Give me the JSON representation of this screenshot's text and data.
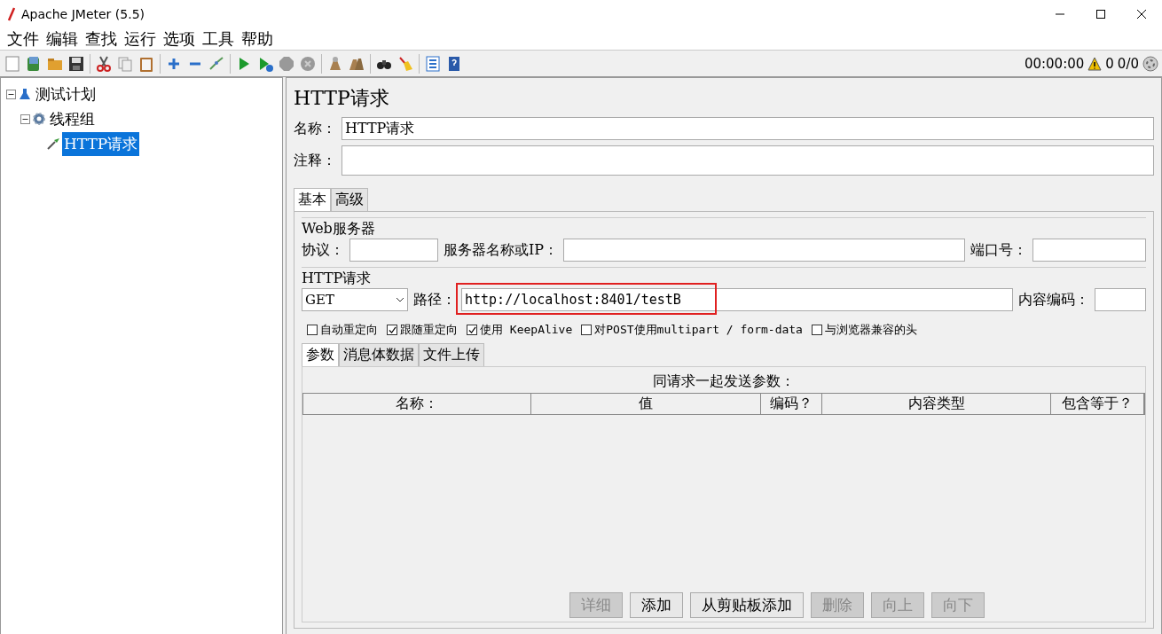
{
  "window": {
    "title": "Apache JMeter (5.5)"
  },
  "menu": [
    "文件",
    "编辑",
    "查找",
    "运行",
    "选项",
    "工具",
    "帮助"
  ],
  "status": {
    "elapsed": "00:00:00",
    "warnings": "0",
    "threads": "0/0"
  },
  "tree": [
    {
      "label": "测试计划",
      "kind": "plan",
      "expanded": true,
      "selected": false,
      "children": [
        {
          "label": "线程组",
          "kind": "group",
          "expanded": true,
          "selected": false,
          "children": [
            {
              "label": "HTTP请求",
              "kind": "sampler",
              "selected": true
            }
          ]
        }
      ]
    }
  ],
  "panel": {
    "title": "HTTP请求",
    "name_label": "名称：",
    "name_value": "HTTP请求",
    "comments_label": "注释："
  },
  "tabs": [
    {
      "label": "基本",
      "selected": true
    },
    {
      "label": "高级",
      "selected": false
    }
  ],
  "web_server": {
    "title": "Web服务器",
    "protocol_label": "协议：",
    "server_label": "服务器名称或IP：",
    "port_label": "端口号："
  },
  "http_request": {
    "title": "HTTP请求",
    "method": "GET",
    "path_label": "路径：",
    "path_value": "http://localhost:8401/testB",
    "path_highlighted": true,
    "encoding_label": "内容编码："
  },
  "options": [
    {
      "label": "自动重定向",
      "checked": false
    },
    {
      "label": "跟随重定向",
      "checked": true
    },
    {
      "label": "使用 KeepAlive",
      "checked": true
    },
    {
      "label": "对POST使用multipart / form-data",
      "checked": false
    },
    {
      "label": "与浏览器兼容的头",
      "checked": false
    }
  ],
  "sub_tabs": [
    {
      "label": "参数",
      "selected": true
    },
    {
      "label": "消息体数据",
      "selected": false
    },
    {
      "label": "文件上传",
      "selected": false
    }
  ],
  "params": {
    "caption": "同请求一起发送参数：",
    "columns": [
      "名称：",
      "值",
      "编码？",
      "内容类型",
      "包含等于？"
    ]
  },
  "buttons": [
    {
      "label": "详细",
      "disabled": true
    },
    {
      "label": "添加",
      "disabled": false
    },
    {
      "label": "从剪贴板添加",
      "disabled": false
    },
    {
      "label": "删除",
      "disabled": true
    },
    {
      "label": "向上",
      "disabled": true
    },
    {
      "label": "向下",
      "disabled": true
    }
  ]
}
